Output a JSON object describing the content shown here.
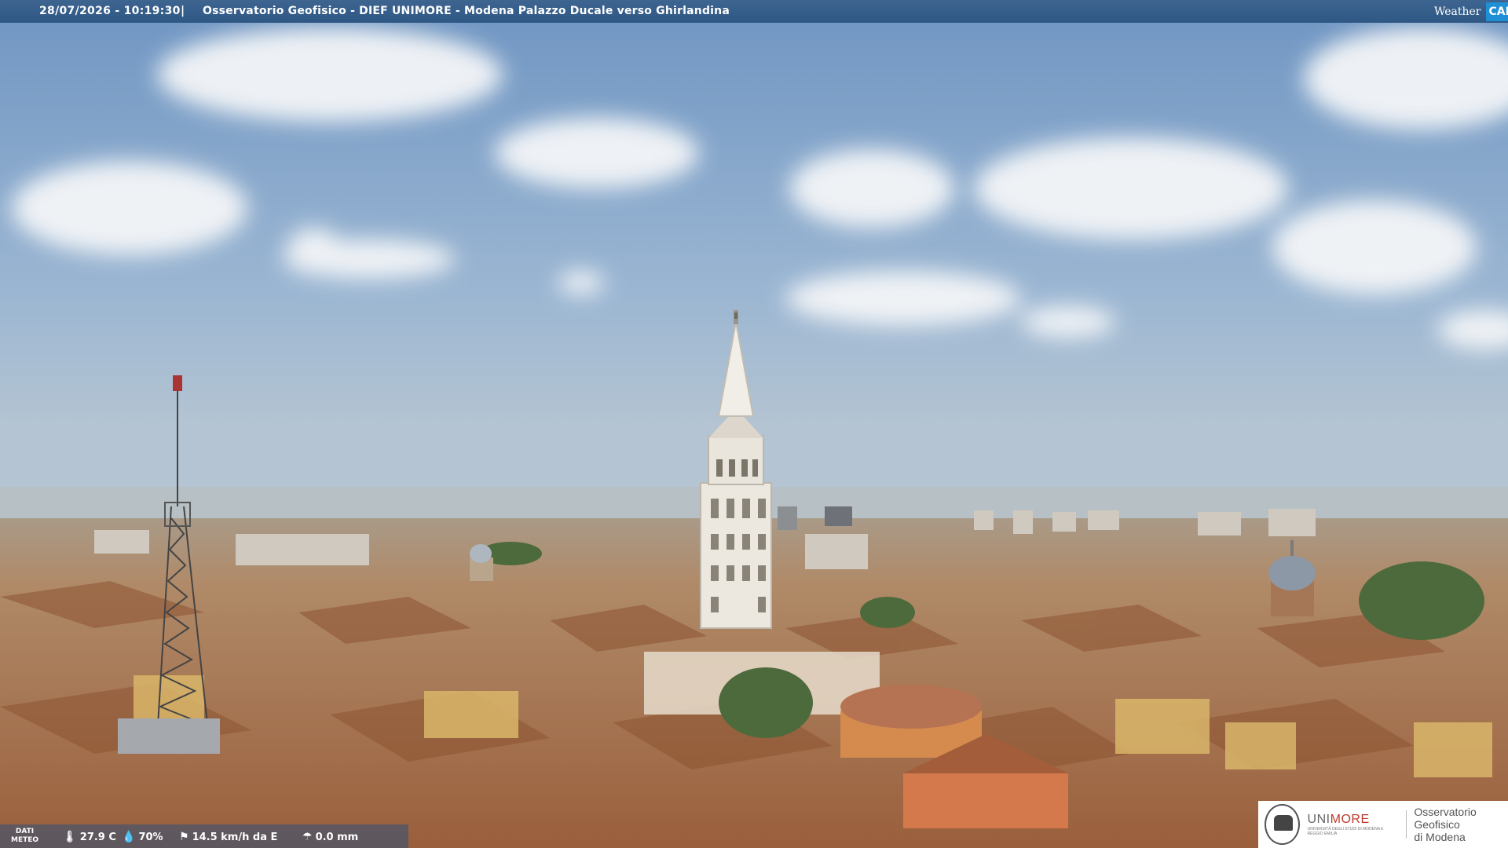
{
  "header": {
    "timestamp": "28/07/2026 - 10:19:30",
    "separator": "|",
    "caption": "Osservatorio Geofisico - DIEF UNIMORE - Modena Palazzo Ducale verso Ghirlandina"
  },
  "logo": {
    "weather": "Weather",
    "cam": "CAM"
  },
  "meteo": {
    "label_line1": "DATI",
    "label_line2": "METEO",
    "temperature": "27.9 C",
    "humidity": "70%",
    "wind": "14.5 km/h da E",
    "rain": "0.0 mm",
    "icons": [
      "thermometer-icon",
      "humidity-drop-icon",
      "wind-icon",
      "rain-icon"
    ]
  },
  "brand": {
    "uni_prefix": "UNI",
    "uni_suffix": "MORE",
    "uni_subtitle": "UNIVERSITÀ DEGLI STUDI DI MODENA E REGGIO EMILIA",
    "obs_line1": "Osservatorio Geofisico",
    "obs_line2": "di Modena"
  },
  "colors": {
    "header_bg": "#2e5784",
    "accent_red": "#c03a2b",
    "cam_blue": "#1f8fd6"
  }
}
